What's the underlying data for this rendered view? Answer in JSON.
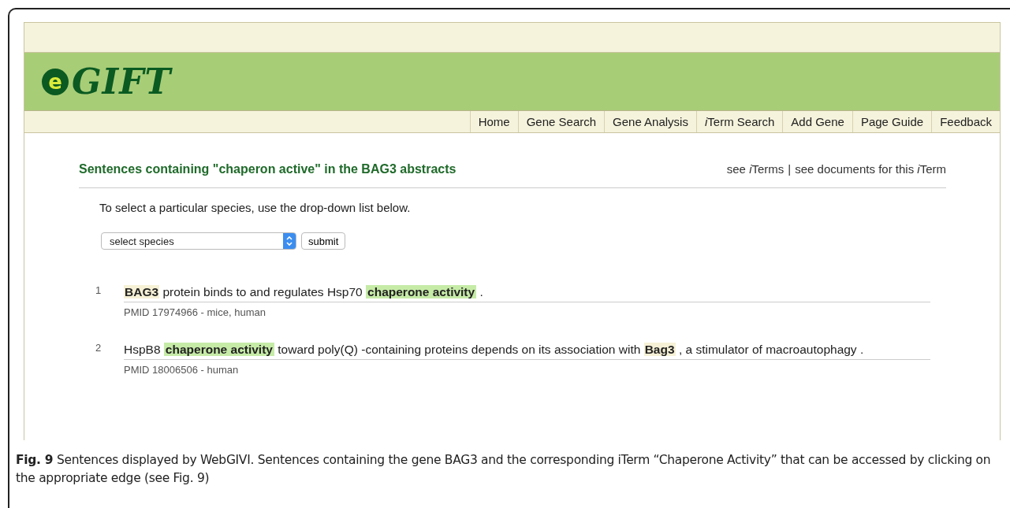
{
  "site": {
    "logo_mark": "e",
    "logo_text": "GIFT"
  },
  "nav": [
    {
      "label": "Home"
    },
    {
      "label": "Gene Search"
    },
    {
      "label": "Gene Analysis"
    },
    {
      "parts": [
        {
          "text": "i",
          "italic": true
        },
        {
          "text": "Term Search",
          "italic": false
        }
      ]
    },
    {
      "label": "Add Gene"
    },
    {
      "label": "Page Guide"
    },
    {
      "label": "Feedback"
    }
  ],
  "heading": "Sentences containing \"chaperon active\" in the BAG3 abstracts",
  "links": [
    {
      "parts": [
        {
          "text": "see ",
          "italic": false
        },
        {
          "text": "i",
          "italic": true
        },
        {
          "text": "Terms",
          "italic": false
        }
      ]
    },
    {
      "parts": [
        {
          "text": "see documents for this ",
          "italic": false
        },
        {
          "text": "i",
          "italic": true
        },
        {
          "text": "Term",
          "italic": false
        }
      ]
    }
  ],
  "link_separator": "|",
  "instruction": "To select a particular species, use the drop-down list below.",
  "species_select": {
    "value": "select species"
  },
  "submit_button": "submit",
  "sentences": [
    {
      "number": "1",
      "segments": [
        {
          "kind": "gene",
          "text": "BAG3"
        },
        {
          "kind": "text",
          "text": "protein binds to and regulates Hsp70"
        },
        {
          "kind": "iterm",
          "text": "chaperone activity"
        },
        {
          "kind": "text",
          "text": "."
        }
      ],
      "source": "PMID 17974966 - mice, human"
    },
    {
      "number": "2",
      "segments": [
        {
          "kind": "text",
          "text": "HspB8"
        },
        {
          "kind": "iterm",
          "text": "chaperone activity"
        },
        {
          "kind": "text",
          "text": "toward poly(Q) -containing proteins depends on its association with"
        },
        {
          "kind": "gene",
          "text": "Bag3"
        },
        {
          "kind": "text",
          "text": ", a stimulator of macroautophagy ."
        }
      ],
      "source": "PMID 18006506 - human"
    }
  ],
  "caption": "**Fig. 9** Sentences displayed by WebGIVI. Sentences containing the gene BAG3 and the corresponding iTerm “Chaperone Activity” that can be accessed by clicking on the appropriate edge (see Fig. 9)"
}
